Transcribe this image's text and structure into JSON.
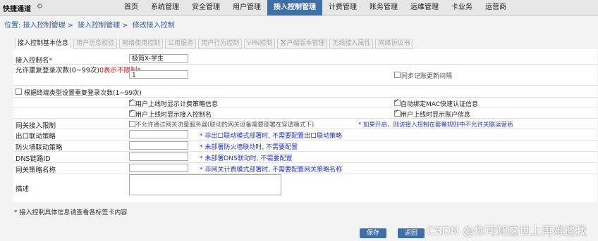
{
  "app": {
    "name": "快捷通道"
  },
  "nav": [
    "首页",
    "系统管理",
    "安全管理",
    "用户管理",
    "接入控制管理",
    "计费管理",
    "账务管理",
    "运维管理",
    "卡业务",
    "运营商"
  ],
  "breadcrumb": {
    "prefix": "位置:",
    "items": [
      "接入控制管理",
      "接入控制管理",
      "修改接入控制"
    ]
  },
  "tabs": [
    "接入控制基本信息",
    "用户信息校验",
    "网络使用控制",
    "公用服务",
    "用户行为控制",
    "VPN控制",
    "客户端版本管理",
    "无线接入属性",
    "网络协议书"
  ],
  "form": {
    "name_label": "接入控制名",
    "name_value": "极简X-学生",
    "retry_label": "允许重复登录次数(0~99次)",
    "retry_red": "0表示不限制",
    "retry_value": "1",
    "sync_label": "同步记账更新间隔",
    "terminal_label": "根据终端类型设置重复登录次数(1~99次)",
    "show_billing": "用户上线时显示计费策略信息",
    "auto_mac": "自动绑定MAC快速认证信息",
    "show_access": "用户上线时显示接入控制名",
    "show_account": "用户上线时显示账户信息",
    "gw_label": "网关接入限制",
    "gw_opt": "不允许通过网关流量服务器(联动的网关设备需要部署在穿透模式下)",
    "gw_hint": "* 如果开启，则该接入控制在套餐规则中不允许关联运营商",
    "exit_label": "出口联动策略",
    "exit_hint": "* 非出口联动模式部署时, 不需要配置出口联动策略",
    "fw_label": "防火墙联动策略",
    "fw_hint": "* 未部署防火墙联动时, 不需要配置",
    "dns_label": "DNS链路ID",
    "dns_hint": "* 未部署DNS联动时, 不需要配置",
    "gwp_label": "网关策略名称",
    "gwp_hint": "* 非网关计费模式部署时, 不需要配置网关策略名称",
    "desc_label": "描述"
  },
  "footnote": "* 接入控制具体信息请查看各标签卡内容",
  "buttons": {
    "save": "保存",
    "back": "返回"
  },
  "watermark": "CSDN @你可知这世上再难遇我"
}
